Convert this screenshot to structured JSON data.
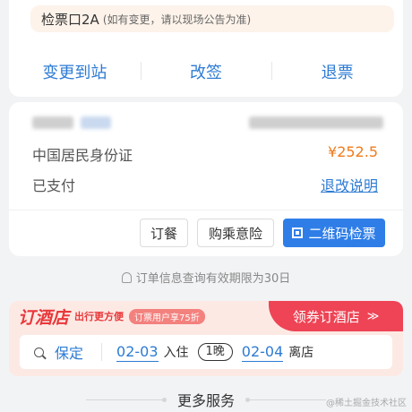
{
  "gate": {
    "main": "检票口2A",
    "note": "(如有变更，请以现场公告为准)"
  },
  "actions": [
    "变更到站",
    "改签",
    "退票"
  ],
  "passenger": {
    "id_type": "中国居民身份证",
    "price": "¥252.5",
    "pay_status": "已支付",
    "refund_policy_link": "退改说明"
  },
  "buttons": {
    "meal": "订餐",
    "insurance": "购乘意险",
    "qr_check": "二维码检票"
  },
  "notice": "订单信息查询有效期限为30日",
  "hotel": {
    "logo": "订酒店",
    "slogan": "出行更方便",
    "badge": "订票用户享75折",
    "coupon": "领券订酒店",
    "coupon_chevron": "≫",
    "guarantee": "保定",
    "checkin_date": "02-03",
    "checkin_label": "入住",
    "nights": "1晚",
    "checkout_date": "02-04",
    "checkout_label": "离店"
  },
  "more_services": "更多服务",
  "watermark": "@稀土掘金技术社区",
  "colors": {
    "accent_blue": "#2d7bd4",
    "price_orange": "#f07b1a",
    "hotel_red": "#e8383b"
  }
}
